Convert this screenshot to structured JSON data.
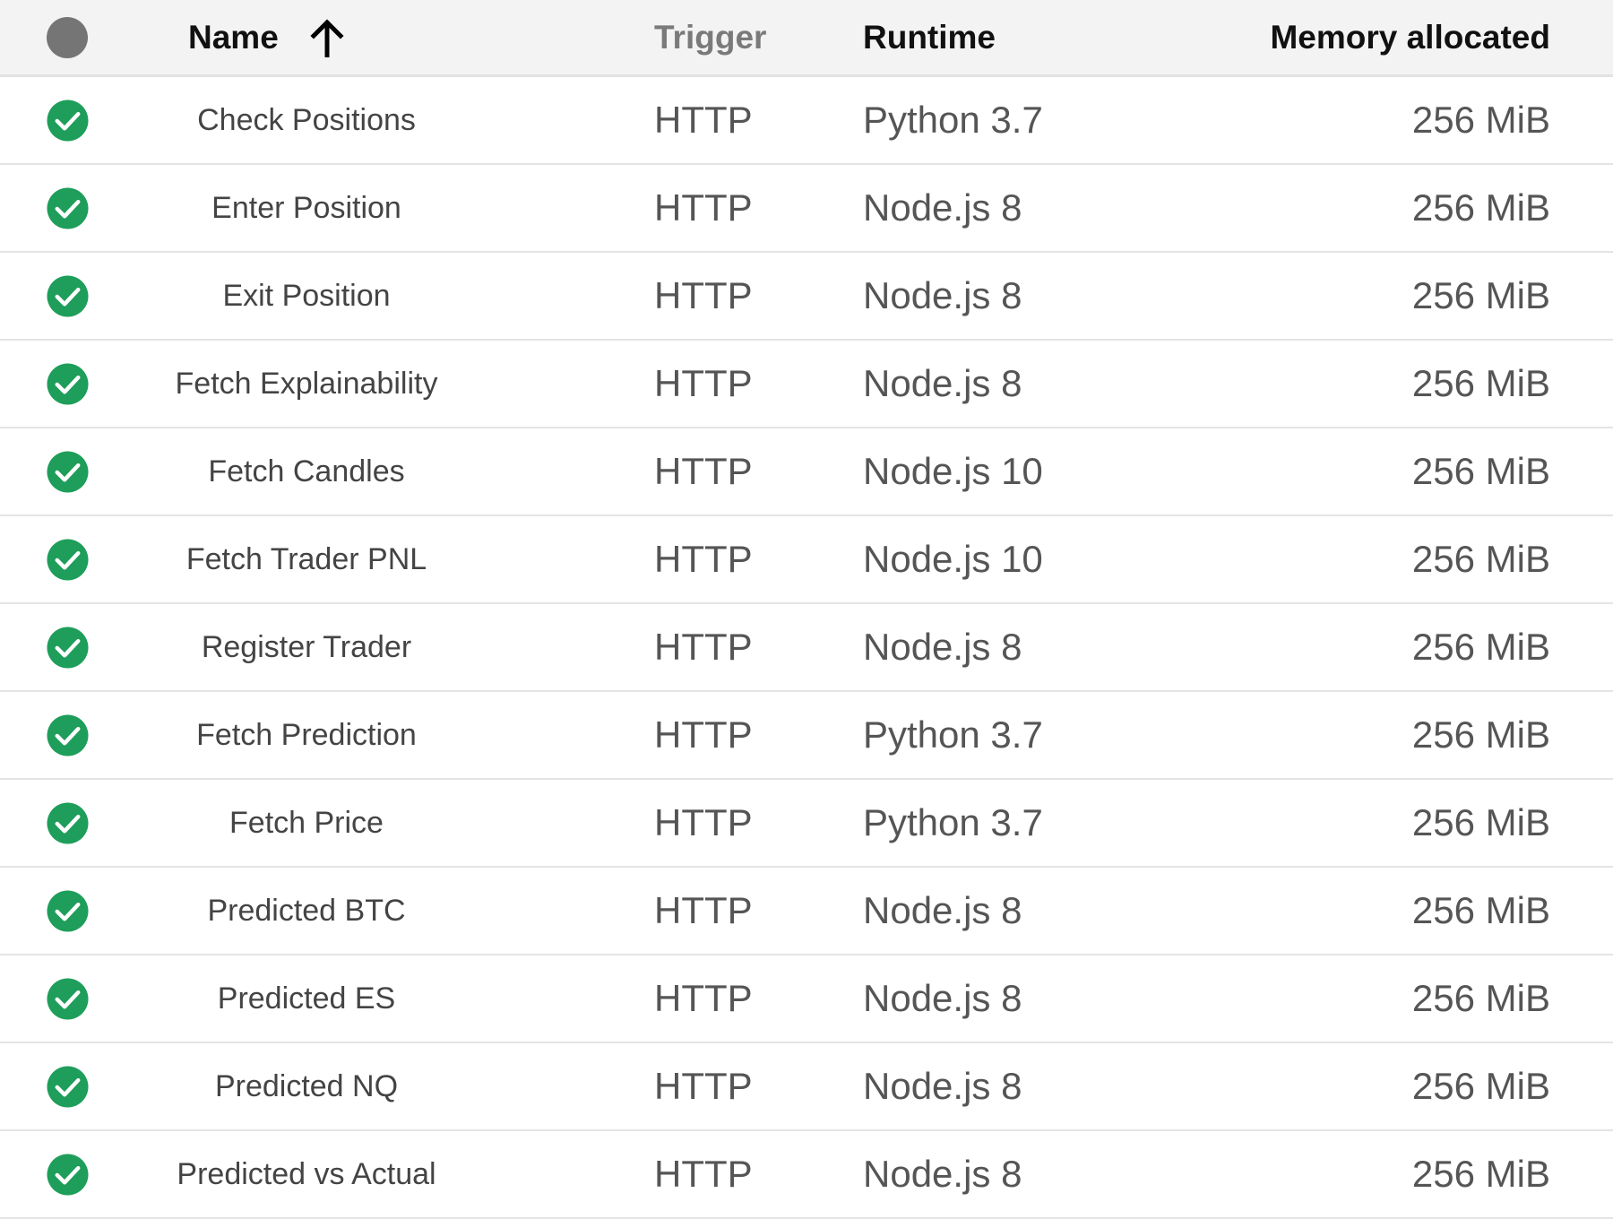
{
  "table": {
    "columns": {
      "status": "",
      "name": "Name",
      "trigger": "Trigger",
      "runtime": "Runtime",
      "memory": "Memory allocated"
    },
    "sort": {
      "column": "name",
      "direction": "ascending",
      "icon": "arrow-up-icon"
    },
    "header_status_icon": "status-dot-icon",
    "colors": {
      "ok": "#1e9e5a",
      "header_dot": "#757575",
      "header_bg": "#f3f3f3"
    },
    "rows": [
      {
        "status": "ok",
        "name": "Check Positions",
        "trigger": "HTTP",
        "runtime": "Python 3.7",
        "memory": "256 MiB"
      },
      {
        "status": "ok",
        "name": "Enter Position",
        "trigger": "HTTP",
        "runtime": "Node.js 8",
        "memory": "256 MiB"
      },
      {
        "status": "ok",
        "name": "Exit Position",
        "trigger": "HTTP",
        "runtime": "Node.js 8",
        "memory": "256 MiB"
      },
      {
        "status": "ok",
        "name": "Fetch Explainability",
        "trigger": "HTTP",
        "runtime": "Node.js 8",
        "memory": "256 MiB"
      },
      {
        "status": "ok",
        "name": "Fetch Candles",
        "trigger": "HTTP",
        "runtime": "Node.js 10",
        "memory": "256 MiB"
      },
      {
        "status": "ok",
        "name": "Fetch Trader PNL",
        "trigger": "HTTP",
        "runtime": "Node.js 10",
        "memory": "256 MiB"
      },
      {
        "status": "ok",
        "name": "Register Trader",
        "trigger": "HTTP",
        "runtime": "Node.js 8",
        "memory": "256 MiB"
      },
      {
        "status": "ok",
        "name": "Fetch Prediction",
        "trigger": "HTTP",
        "runtime": "Python 3.7",
        "memory": "256 MiB"
      },
      {
        "status": "ok",
        "name": "Fetch Price",
        "trigger": "HTTP",
        "runtime": "Python 3.7",
        "memory": "256 MiB"
      },
      {
        "status": "ok",
        "name": "Predicted BTC",
        "trigger": "HTTP",
        "runtime": "Node.js 8",
        "memory": "256 MiB"
      },
      {
        "status": "ok",
        "name": "Predicted ES",
        "trigger": "HTTP",
        "runtime": "Node.js 8",
        "memory": "256 MiB"
      },
      {
        "status": "ok",
        "name": "Predicted NQ",
        "trigger": "HTTP",
        "runtime": "Node.js 8",
        "memory": "256 MiB"
      },
      {
        "status": "ok",
        "name": "Predicted vs Actual",
        "trigger": "HTTP",
        "runtime": "Node.js 8",
        "memory": "256 MiB"
      }
    ]
  }
}
